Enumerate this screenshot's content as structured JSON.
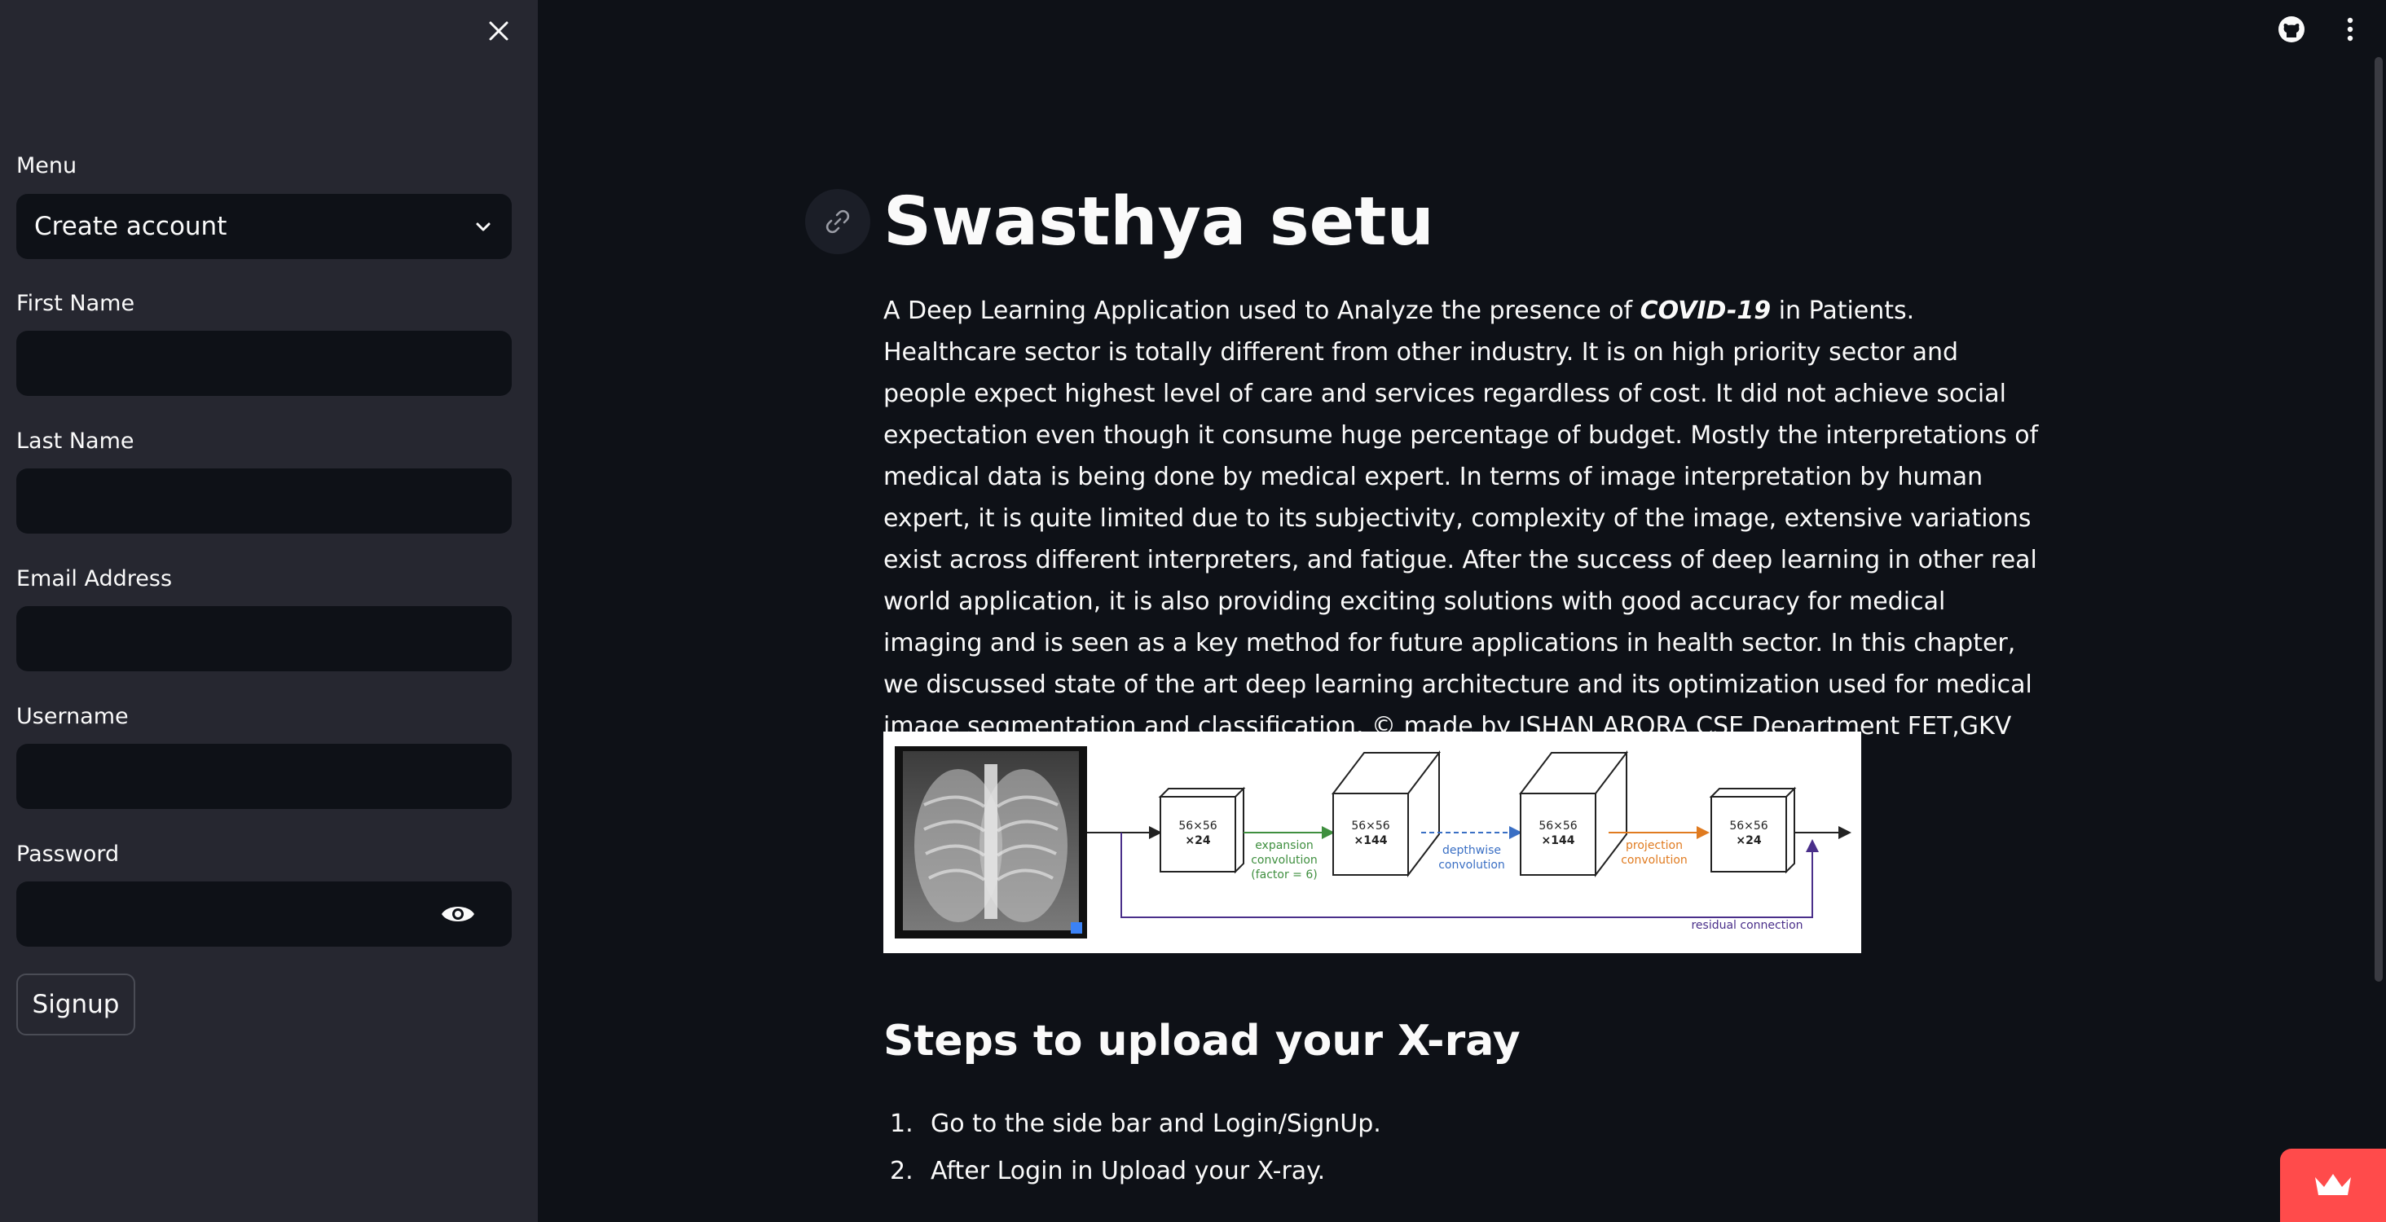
{
  "sidebar": {
    "menu_label": "Menu",
    "menu_selected": "Create account",
    "fields": {
      "first_name": "First Name",
      "last_name": "Last Name",
      "email": "Email Address",
      "username": "Username",
      "password": "Password"
    },
    "signup_label": "Signup"
  },
  "main": {
    "title": "Swasthya setu",
    "intro_before": "A Deep Learning Application used to Analyze the presence of ",
    "intro_emphasis": "COVID-19",
    "intro_after": " in Patients. Healthcare sector is totally different from other industry. It is on high priority sector and people expect highest level of care and services regardless of cost. It did not achieve social expectation even though it consume huge percentage of budget. Mostly the interpretations of medical data is being done by medical expert. In terms of image interpretation by human expert, it is quite limited due to its subjectivity, complexity of the image, extensive variations exist across different interpreters, and fatigue. After the success of deep learning in other real world application, it is also providing exciting solutions with good accuracy for medical imaging and is seen as a key method for future applications in health sector. In this chapter, we discussed state of the art deep learning architecture and its optimization used for medical image segmentation and classification. © made by ISHAN ARORA CSE Department FET,GKV Haridwar",
    "figure": {
      "block_dims": "56×56",
      "block1_channels": "×24",
      "block2_channels": "×144",
      "block3_channels": "×144",
      "block4_channels": "×24",
      "expansion_label_1": "expansion",
      "expansion_label_2": "convolution",
      "expansion_label_3": "(factor = 6)",
      "depthwise_label_1": "depthwise",
      "depthwise_label_2": "convolution",
      "projection_label_1": "projection",
      "projection_label_2": "convolution",
      "residual_label": "residual connection"
    },
    "steps_title": "Steps to upload your X-ray",
    "steps": [
      {
        "num": "1.",
        "text": "Go to the side bar and Login/SignUp."
      },
      {
        "num": "2.",
        "text": "After Login in Upload your X-ray."
      }
    ]
  },
  "icons": {
    "close": "close-icon",
    "chevron": "chevron-down-icon",
    "eye": "eye-icon",
    "link": "link-icon",
    "github": "github-icon",
    "menu": "kebab-menu-icon",
    "crown": "crown-icon"
  },
  "colors": {
    "app_bg": "#0e1117",
    "sidebar_bg": "#262730",
    "accent": "#ff4b4b"
  }
}
